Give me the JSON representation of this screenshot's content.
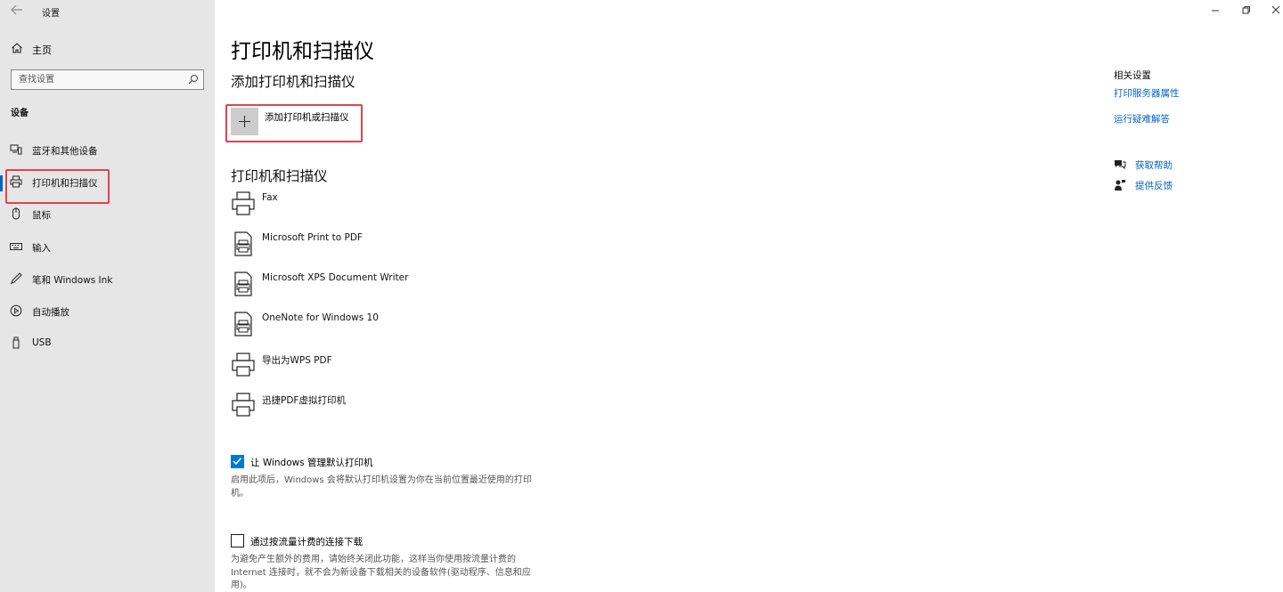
{
  "window": {
    "title": "设置"
  },
  "sidebar": {
    "home_label": "主页",
    "search_placeholder": "查找设置",
    "section_label": "设备",
    "items": [
      {
        "label": "蓝牙和其他设备",
        "icon": "bluetooth-devices-icon"
      },
      {
        "label": "打印机和扫描仪",
        "icon": "printer-icon",
        "active": true
      },
      {
        "label": "鼠标",
        "icon": "mouse-icon"
      },
      {
        "label": "输入",
        "icon": "keyboard-icon"
      },
      {
        "label": "笔和 Windows Ink",
        "icon": "pen-icon"
      },
      {
        "label": "自动播放",
        "icon": "autoplay-icon"
      },
      {
        "label": "USB",
        "icon": "usb-icon"
      }
    ]
  },
  "main": {
    "title": "打印机和扫描仪",
    "add_heading": "添加打印机和扫描仪",
    "add_button_label": "添加打印机或扫描仪",
    "list_heading": "打印机和扫描仪",
    "printers": [
      {
        "name": "Fax",
        "icon": "fax-printer-icon"
      },
      {
        "name": "Microsoft Print to PDF",
        "icon": "document-printer-icon"
      },
      {
        "name": "Microsoft XPS Document Writer",
        "icon": "document-printer-icon"
      },
      {
        "name": "OneNote for Windows 10",
        "icon": "document-printer-icon"
      },
      {
        "name": "导出为WPS PDF",
        "icon": "printer-icon"
      },
      {
        "name": "迅捷PDF虚拟打印机",
        "icon": "printer-icon"
      }
    ],
    "let_windows_manage": {
      "label": "让 Windows 管理默认打印机",
      "checked": true,
      "description": "启用此项后，Windows 会将默认打印机设置为你在当前位置最近使用的打印机。"
    },
    "metered_download": {
      "label": "通过按流量计费的连接下载",
      "checked": false,
      "description": "为避免产生额外的费用，请始终关闭此功能，这样当你使用按流量计费的 Internet 连接时，就不会为新设备下载相关的设备软件(驱动程序、信息和应用)。"
    }
  },
  "related": {
    "heading": "相关设置",
    "links": [
      "打印服务器属性",
      "运行疑难解答"
    ],
    "help_label": "获取帮助",
    "feedback_label": "提供反馈"
  },
  "colors": {
    "accent": "#0067c0",
    "highlight_box": "#e0434f",
    "sidebar_bg": "#e6e6e6"
  }
}
